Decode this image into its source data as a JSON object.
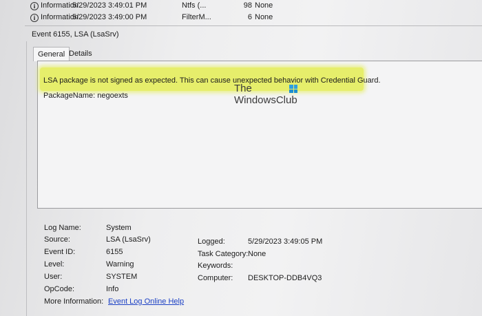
{
  "event_list": {
    "rows": [
      {
        "level": "Information",
        "datetime": "5/29/2023 3:49:01 PM",
        "source": "Ntfs (...",
        "event_id": "98",
        "category": "None"
      },
      {
        "level": "Information",
        "datetime": "5/29/2023 3:49:00 PM",
        "source": "FilterM...",
        "event_id": "6",
        "category": "None"
      }
    ],
    "icon": "info-icon"
  },
  "event_header": {
    "title": "Event 6155, LSA (LsaSrv)"
  },
  "tabs": [
    {
      "label": "General",
      "active": true
    },
    {
      "label": "Details",
      "active": false
    }
  ],
  "message": {
    "line1": "LSA package is not signed as expected. This can cause unexpected behavior with Credential Guard.",
    "line2": "PackageName: negoexts",
    "highlight_color": "#e2ec3c"
  },
  "watermark": {
    "line1": "The",
    "line2": "WindowsClub",
    "icon": "windows-logo-icon"
  },
  "properties": {
    "log_name": {
      "label": "Log Name:",
      "value": "System"
    },
    "source": {
      "label": "Source:",
      "value": "LSA (LsaSrv)"
    },
    "event_id": {
      "label": "Event ID:",
      "value": "6155"
    },
    "level": {
      "label": "Level:",
      "value": "Warning"
    },
    "user": {
      "label": "User:",
      "value": "SYSTEM"
    },
    "opcode": {
      "label": "OpCode:",
      "value": "Info"
    },
    "more_info": {
      "label": "More Information:",
      "value": "Event Log Online Help"
    },
    "logged": {
      "label": "Logged:",
      "value": "5/29/2023 3:49:05 PM"
    },
    "task_category": {
      "label": "Task Category:",
      "value": "None"
    },
    "keywords": {
      "label": "Keywords:",
      "value": ""
    },
    "computer": {
      "label": "Computer:",
      "value": "DESKTOP-DDB4VQ3"
    }
  },
  "colors": {
    "link": "#1a3fc4"
  }
}
